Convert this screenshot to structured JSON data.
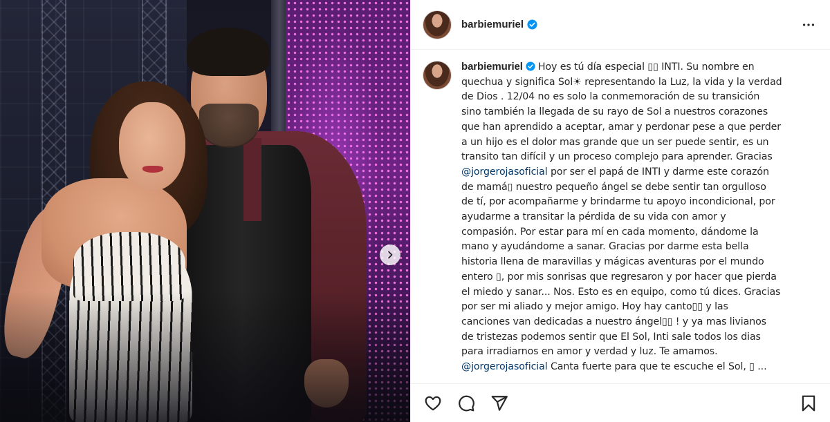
{
  "post": {
    "username": "barbiemuriel",
    "verified": true,
    "accent_color": "#0095f6",
    "mention_color": "#00376b"
  },
  "caption": {
    "username": "barbiemuriel",
    "lines": [
      "Hoy es tú día especial ▯▯ INTI. Su nombre en",
      "quechua y significa Sol☀ representando la Luz, la vida y la verdad",
      "de Dios . 12/04 no es solo la conmemoración de su transición",
      "sino también la llegada de su rayo de Sol a nuestros corazones",
      "que han aprendido a aceptar, amar y perdonar pese a que perder",
      "a un hijo es el dolor mas grande que un ser puede sentir, es un",
      "transito tan difícil y un proceso complejo para aprender. Gracias",
      "por ser el papá de INTI y darme este corazón",
      "de mamá▯ nuestro pequeño ángel se debe sentir tan orgulloso",
      "de tí, por acompañarme y brindarme tu apoyo incondicional, por",
      "ayudarme a transitar la pérdida de su vida con amor y",
      "compasión. Por estar para mí en cada momento, dándome la",
      "mano y ayudándome a sanar. Gracias por darme esta bella",
      "historia llena de maravillas y mágicas aventuras por el mundo",
      "entero ▯, por mis sonrisas que regresaron y por hacer que pierda",
      "el miedo y sanar... Nos. Esto es en equipo, como tú dices. Gracias",
      "por ser mi aliado y mejor amigo. Hoy hay canto▯▯ y las",
      "canciones van dedicadas a nuestro ángel▯▯ ! y ya mas livianos",
      "de tristezas podemos sentir que El Sol, Inti sale todos los dias",
      "para irradiarnos en amor y verdad y luz. Te amamos.",
      "Canta fuerte para que te escuche el Sol, ▯ ..."
    ],
    "mention": "@jorgerojasoficial"
  },
  "icons": {
    "more": "more-options-icon",
    "like": "heart-icon",
    "comment": "comment-icon",
    "share": "share-icon",
    "save": "bookmark-icon",
    "next": "chevron-right-icon",
    "verified": "verified-badge-icon"
  }
}
